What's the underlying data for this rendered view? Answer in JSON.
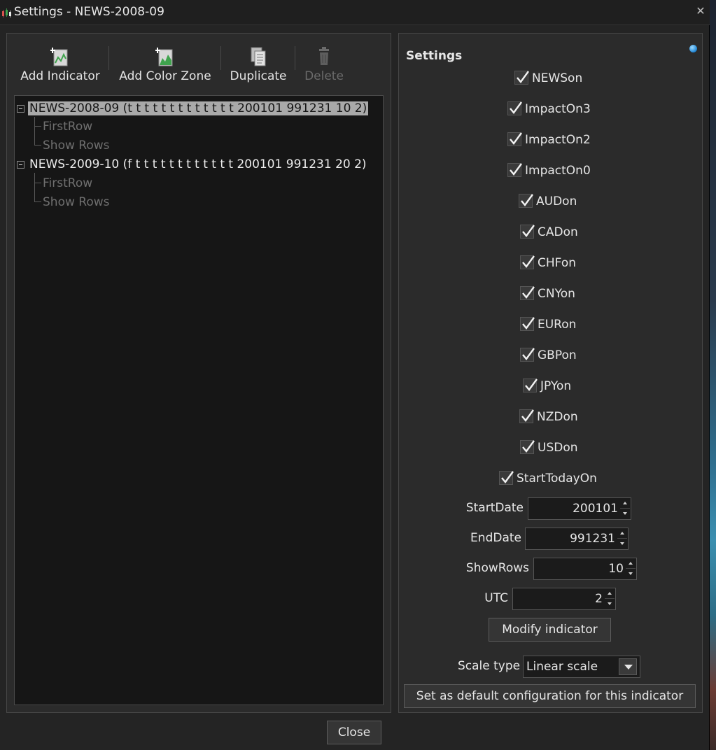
{
  "window": {
    "title": "Settings - NEWS-2008-09"
  },
  "toolbar": {
    "add_indicator": "Add Indicator",
    "add_color_zone": "Add Color Zone",
    "duplicate": "Duplicate",
    "delete": "Delete"
  },
  "tree": {
    "items": [
      {
        "label": "NEWS-2008-09 (t t t t t t t t t t t t t 200101 991231 10 2)",
        "selected": true,
        "children": [
          "FirstRow",
          "Show Rows"
        ]
      },
      {
        "label": "NEWS-2009-10 (f t t t t t t t t t t t t 200101 991231 20 2)",
        "selected": false,
        "children": [
          "FirstRow",
          "Show Rows"
        ]
      }
    ]
  },
  "settings": {
    "title": "Settings",
    "checkboxes": [
      {
        "label": "NEWSon",
        "checked": true
      },
      {
        "label": "ImpactOn3",
        "checked": true
      },
      {
        "label": "ImpactOn2",
        "checked": true
      },
      {
        "label": "ImpactOn0",
        "checked": true
      },
      {
        "label": "AUDon",
        "checked": true
      },
      {
        "label": "CADon",
        "checked": true
      },
      {
        "label": "CHFon",
        "checked": true
      },
      {
        "label": "CNYon",
        "checked": true
      },
      {
        "label": "EURon",
        "checked": true
      },
      {
        "label": "GBPon",
        "checked": true
      },
      {
        "label": "JPYon",
        "checked": true
      },
      {
        "label": "NZDon",
        "checked": true
      },
      {
        "label": "USDon",
        "checked": true
      },
      {
        "label": "StartTodayOn",
        "checked": true
      }
    ],
    "fields": [
      {
        "label": "StartDate",
        "value": "200101"
      },
      {
        "label": "EndDate",
        "value": "991231"
      },
      {
        "label": "ShowRows",
        "value": "10"
      },
      {
        "label": "UTC",
        "value": "2"
      }
    ],
    "modify_button": "Modify indicator",
    "scale_type_label": "Scale type",
    "scale_type_value": "Linear scale",
    "default_button": "Set as default configuration for this indicator"
  },
  "footer": {
    "close_button": "Close"
  },
  "colors": {
    "accent_dot": "#1e84d4",
    "selection": "#a9a9a9",
    "icon_green": "#3fa34d"
  }
}
